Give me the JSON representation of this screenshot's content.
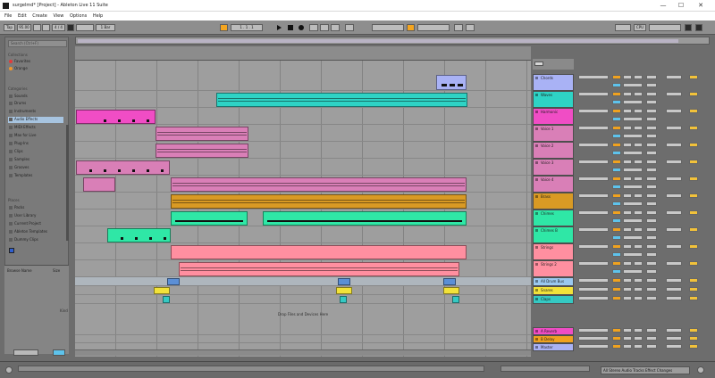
{
  "window": {
    "title": "surgelmd* [Project] - Ableton Live 11 Suite",
    "minimize": "—",
    "maximize": "☐",
    "close": "✕"
  },
  "menu": [
    "File",
    "Edit",
    "Create",
    "View",
    "Options",
    "Help"
  ],
  "toolbar": {
    "tap": "Tap",
    "tempo": "95.00",
    "time_signature": "4 / 4",
    "quantize": "1 Bar",
    "position": "1 . 1 . 1",
    "cpu": "CPU"
  },
  "browser": {
    "search_placeholder": "Search (Ctrl+F)",
    "collections_header": "Collections",
    "collections": [
      {
        "label": "Favorites",
        "color": "#e23b3b"
      },
      {
        "label": "Orange",
        "color": "#f0962a"
      }
    ],
    "categories_header": "Categories",
    "categories": [
      "Sounds",
      "Drums",
      "Instruments",
      "Audio Effects",
      "MIDI Effects",
      "Max for Live",
      "Plug-Ins",
      "Clips",
      "Samples",
      "Grooves",
      "Templates"
    ],
    "selected_category": "Audio Effects",
    "places_header": "Places",
    "places": [
      "Packs",
      "User Library",
      "Current Project",
      "Ableton Templates",
      "Dummy Clips"
    ],
    "info_name_label": "Browse Name",
    "info_size_label": "Size",
    "info_kind": "Kind"
  },
  "arrangement": {
    "center_hint": "Drop Files and Devices Here"
  },
  "tracks": [
    {
      "name": "Chords",
      "color": "#a9b2f5"
    },
    {
      "name": "Waves",
      "color": "#2ed3c5"
    },
    {
      "name": "Harmonic",
      "color": "#f04dc5"
    },
    {
      "name": "Voice 1",
      "color": "#d97fb7"
    },
    {
      "name": "Voice 2",
      "color": "#d97fb7"
    },
    {
      "name": "Voice 3",
      "color": "#d97fb7"
    },
    {
      "name": "Voice 4",
      "color": "#d97fb7"
    },
    {
      "name": "Brass",
      "color": "#d99a24"
    },
    {
      "name": "Chimes",
      "color": "#2fe7a6"
    },
    {
      "name": "Chimes B",
      "color": "#2fe7a6"
    },
    {
      "name": "Strings",
      "color": "#ff8fa0"
    },
    {
      "name": "Strings 2",
      "color": "#ff8fa0"
    },
    {
      "name": "All Drum Bus",
      "color": "#9ac8f0"
    },
    {
      "name": "Snares",
      "color": "#f2e23a"
    },
    {
      "name": "Claps",
      "color": "#35c9c3"
    }
  ],
  "returns": [
    {
      "name": "A Reverb",
      "color": "#f04dc5"
    },
    {
      "name": "B Delay",
      "color": "#f0a21f"
    },
    {
      "name": "Master",
      "color": "#a9b2f5"
    }
  ],
  "status": {
    "text": "All Stereo Audio Tracks Effect Changes"
  },
  "colors": {
    "accent": "#f4a51f",
    "background": "#6d6d6d",
    "lane_background": "#9e9e9e"
  }
}
